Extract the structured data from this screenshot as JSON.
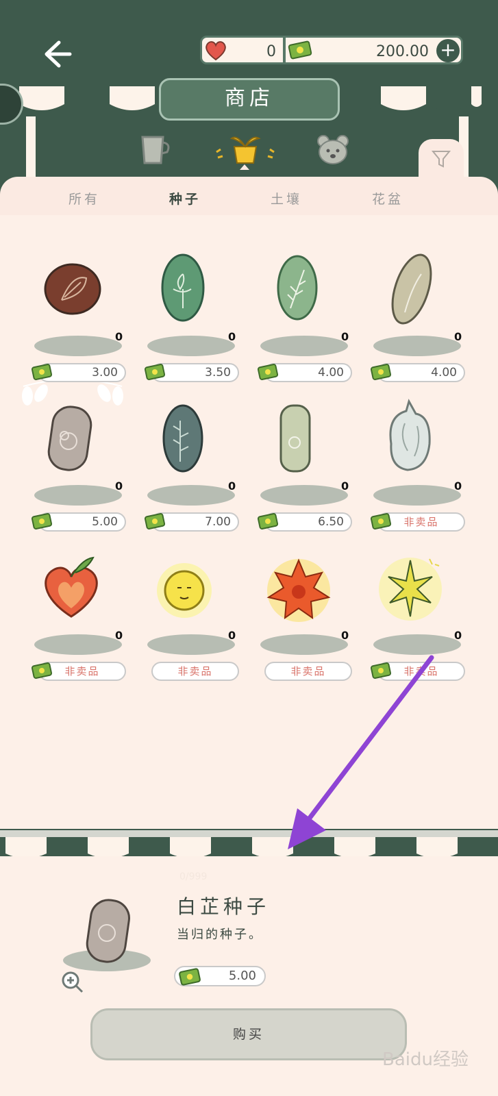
{
  "header": {
    "back_icon": "back-arrow-icon",
    "hearts_value": "0",
    "money_value": "200.00",
    "plus_label": "+",
    "title": "商店"
  },
  "category_icons": [
    "cup-icon",
    "plant-pot-icon",
    "bear-icon",
    "filter-icon"
  ],
  "tabs": [
    {
      "label": "所有",
      "active": false
    },
    {
      "label": "种子",
      "active": true
    },
    {
      "label": "土壤",
      "active": false
    },
    {
      "label": "花盆",
      "active": false
    }
  ],
  "items": [
    {
      "count": "0",
      "price": "3.00",
      "for_sale": true
    },
    {
      "count": "0",
      "price": "3.50",
      "for_sale": true
    },
    {
      "count": "0",
      "price": "4.00",
      "for_sale": true
    },
    {
      "count": "0",
      "price": "4.00",
      "for_sale": true
    },
    {
      "count": "0",
      "price": "5.00",
      "for_sale": true
    },
    {
      "count": "0",
      "price": "7.00",
      "for_sale": true
    },
    {
      "count": "0",
      "price": "6.50",
      "for_sale": true
    },
    {
      "count": "0",
      "price": "非卖品",
      "for_sale": false
    },
    {
      "count": "0",
      "price": "非卖品",
      "for_sale": false
    },
    {
      "count": "0",
      "price": "非卖品",
      "for_sale": false
    },
    {
      "count": "0",
      "price": "非卖品",
      "for_sale": false
    },
    {
      "count": "0",
      "price": "非卖品",
      "for_sale": false
    }
  ],
  "detail": {
    "stock": "0/999",
    "name": "白芷种子",
    "description": "当归的种子。",
    "price": "5.00",
    "buy_label": "购买"
  },
  "watermark": "Baidu经验",
  "colors": {
    "dark_green": "#3e5a4c",
    "panel": "#fbeae2",
    "accent_arrow": "#8e44d4"
  }
}
